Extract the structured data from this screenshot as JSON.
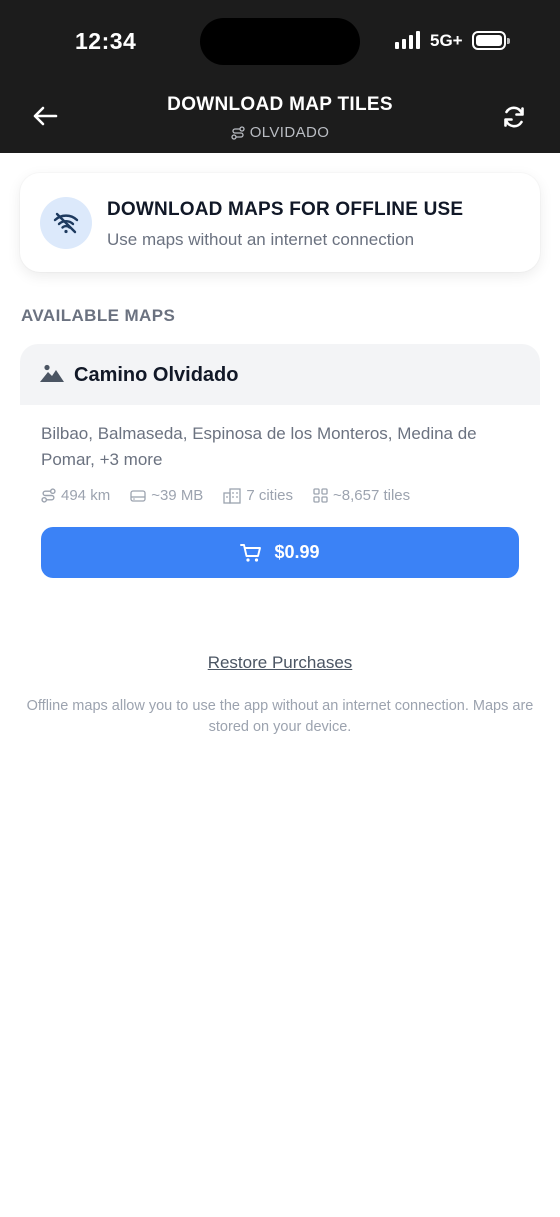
{
  "status_bar": {
    "time": "12:34",
    "network": "5G+"
  },
  "header": {
    "title": "DOWNLOAD MAP TILES",
    "subtitle": "OLVIDADO",
    "icons": {
      "back": "arrow-left-icon",
      "refresh": "refresh-icon",
      "subtitle": "route-icon"
    }
  },
  "info_card": {
    "title": "DOWNLOAD MAPS FOR OFFLINE USE",
    "subtitle": "Use maps without an internet connection",
    "icon": "wifi-off-icon"
  },
  "section": {
    "label": "AVAILABLE MAPS"
  },
  "map_card": {
    "name": "Camino Olvidado",
    "icon": "mountain-icon",
    "cities": "Bilbao, Balmaseda, Espinosa de los Monteros, Medina de Pomar, +3 more",
    "stats": {
      "distance": "494 km",
      "size": "~39 MB",
      "cities_count": "7 cities",
      "tiles": "~8,657 tiles"
    },
    "buy_label": "$0.99"
  },
  "restore_label": "Restore Purchases",
  "footer_note": "Offline maps allow you to use the app without an internet connection. Maps are stored on your device.",
  "colors": {
    "header_bg": "#1c1c1c",
    "accent": "#3b82f6",
    "muted_text": "#6b7280"
  }
}
